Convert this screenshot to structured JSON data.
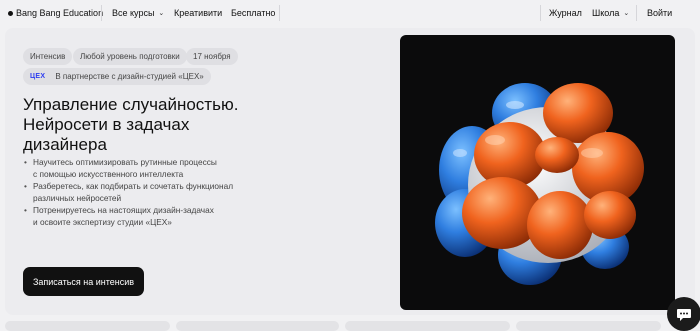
{
  "header": {
    "brand": "Bang Bang Education",
    "nav": {
      "courses": "Все курсы",
      "creative": "Креативити",
      "free": "Бесплатно",
      "journal": "Журнал",
      "school": "Школа",
      "login": "Войти"
    }
  },
  "hero": {
    "tags": [
      "Интенсив",
      "Любой уровень подготовки",
      "17 ноября"
    ],
    "partner": {
      "logo": "ЦЕХ",
      "text": "В партнерстве с дизайн-студией «ЦЕХ»"
    },
    "title": [
      "Управление случайностью.",
      "Нейросети в задачах",
      "дизайнера"
    ],
    "bullets": [
      [
        "Научитесь оптимизировать рутинные процессы",
        "с помощью искусственного интеллекта"
      ],
      [
        "Разберетесь, как подбирать и сочетать функционал",
        "различных нейросетей"
      ],
      [
        "Потренируетесь на настоящих дизайн-задачах",
        "и освоите экспертизу студии «ЦЕХ»"
      ]
    ],
    "cta": "Записаться на интенсив"
  },
  "icons": {
    "courses_chevron": "chevron-down-icon",
    "school_chevron": "chevron-down-icon",
    "chat": "chat-icon"
  },
  "colors": {
    "orange": "#f0631e",
    "blue": "#2f7ee0",
    "artwork_bg": "#0b0b0c",
    "cta_bg": "#111111",
    "partner_logo": "#2d3df0"
  }
}
